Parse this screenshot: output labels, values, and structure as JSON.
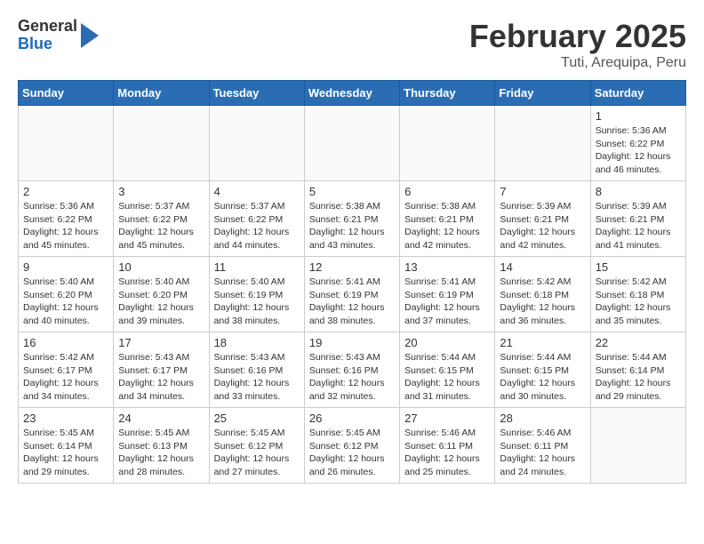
{
  "header": {
    "logo_general": "General",
    "logo_blue": "Blue",
    "month": "February 2025",
    "location": "Tuti, Arequipa, Peru"
  },
  "weekdays": [
    "Sunday",
    "Monday",
    "Tuesday",
    "Wednesday",
    "Thursday",
    "Friday",
    "Saturday"
  ],
  "weeks": [
    [
      {
        "day": "",
        "info": ""
      },
      {
        "day": "",
        "info": ""
      },
      {
        "day": "",
        "info": ""
      },
      {
        "day": "",
        "info": ""
      },
      {
        "day": "",
        "info": ""
      },
      {
        "day": "",
        "info": ""
      },
      {
        "day": "1",
        "info": "Sunrise: 5:36 AM\nSunset: 6:22 PM\nDaylight: 12 hours and 46 minutes."
      }
    ],
    [
      {
        "day": "2",
        "info": "Sunrise: 5:36 AM\nSunset: 6:22 PM\nDaylight: 12 hours and 45 minutes."
      },
      {
        "day": "3",
        "info": "Sunrise: 5:37 AM\nSunset: 6:22 PM\nDaylight: 12 hours and 45 minutes."
      },
      {
        "day": "4",
        "info": "Sunrise: 5:37 AM\nSunset: 6:22 PM\nDaylight: 12 hours and 44 minutes."
      },
      {
        "day": "5",
        "info": "Sunrise: 5:38 AM\nSunset: 6:21 PM\nDaylight: 12 hours and 43 minutes."
      },
      {
        "day": "6",
        "info": "Sunrise: 5:38 AM\nSunset: 6:21 PM\nDaylight: 12 hours and 42 minutes."
      },
      {
        "day": "7",
        "info": "Sunrise: 5:39 AM\nSunset: 6:21 PM\nDaylight: 12 hours and 42 minutes."
      },
      {
        "day": "8",
        "info": "Sunrise: 5:39 AM\nSunset: 6:21 PM\nDaylight: 12 hours and 41 minutes."
      }
    ],
    [
      {
        "day": "9",
        "info": "Sunrise: 5:40 AM\nSunset: 6:20 PM\nDaylight: 12 hours and 40 minutes."
      },
      {
        "day": "10",
        "info": "Sunrise: 5:40 AM\nSunset: 6:20 PM\nDaylight: 12 hours and 39 minutes."
      },
      {
        "day": "11",
        "info": "Sunrise: 5:40 AM\nSunset: 6:19 PM\nDaylight: 12 hours and 38 minutes."
      },
      {
        "day": "12",
        "info": "Sunrise: 5:41 AM\nSunset: 6:19 PM\nDaylight: 12 hours and 38 minutes."
      },
      {
        "day": "13",
        "info": "Sunrise: 5:41 AM\nSunset: 6:19 PM\nDaylight: 12 hours and 37 minutes."
      },
      {
        "day": "14",
        "info": "Sunrise: 5:42 AM\nSunset: 6:18 PM\nDaylight: 12 hours and 36 minutes."
      },
      {
        "day": "15",
        "info": "Sunrise: 5:42 AM\nSunset: 6:18 PM\nDaylight: 12 hours and 35 minutes."
      }
    ],
    [
      {
        "day": "16",
        "info": "Sunrise: 5:42 AM\nSunset: 6:17 PM\nDaylight: 12 hours and 34 minutes."
      },
      {
        "day": "17",
        "info": "Sunrise: 5:43 AM\nSunset: 6:17 PM\nDaylight: 12 hours and 34 minutes."
      },
      {
        "day": "18",
        "info": "Sunrise: 5:43 AM\nSunset: 6:16 PM\nDaylight: 12 hours and 33 minutes."
      },
      {
        "day": "19",
        "info": "Sunrise: 5:43 AM\nSunset: 6:16 PM\nDaylight: 12 hours and 32 minutes."
      },
      {
        "day": "20",
        "info": "Sunrise: 5:44 AM\nSunset: 6:15 PM\nDaylight: 12 hours and 31 minutes."
      },
      {
        "day": "21",
        "info": "Sunrise: 5:44 AM\nSunset: 6:15 PM\nDaylight: 12 hours and 30 minutes."
      },
      {
        "day": "22",
        "info": "Sunrise: 5:44 AM\nSunset: 6:14 PM\nDaylight: 12 hours and 29 minutes."
      }
    ],
    [
      {
        "day": "23",
        "info": "Sunrise: 5:45 AM\nSunset: 6:14 PM\nDaylight: 12 hours and 29 minutes."
      },
      {
        "day": "24",
        "info": "Sunrise: 5:45 AM\nSunset: 6:13 PM\nDaylight: 12 hours and 28 minutes."
      },
      {
        "day": "25",
        "info": "Sunrise: 5:45 AM\nSunset: 6:12 PM\nDaylight: 12 hours and 27 minutes."
      },
      {
        "day": "26",
        "info": "Sunrise: 5:45 AM\nSunset: 6:12 PM\nDaylight: 12 hours and 26 minutes."
      },
      {
        "day": "27",
        "info": "Sunrise: 5:46 AM\nSunset: 6:11 PM\nDaylight: 12 hours and 25 minutes."
      },
      {
        "day": "28",
        "info": "Sunrise: 5:46 AM\nSunset: 6:11 PM\nDaylight: 12 hours and 24 minutes."
      },
      {
        "day": "",
        "info": ""
      }
    ]
  ]
}
